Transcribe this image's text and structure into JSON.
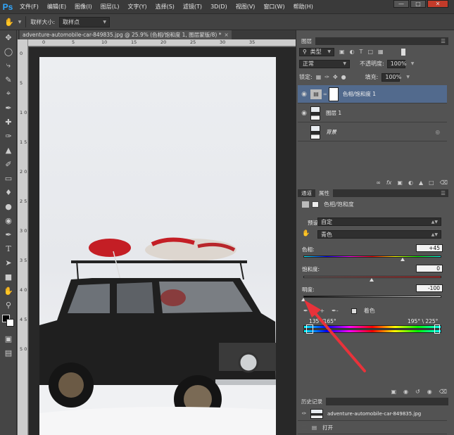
{
  "menu": {
    "logo": "Ps",
    "items": [
      "文件(F)",
      "编辑(E)",
      "图像(I)",
      "图层(L)",
      "文字(Y)",
      "选择(S)",
      "滤镜(T)",
      "3D(D)",
      "视图(V)",
      "窗口(W)",
      "帮助(H)"
    ],
    "win": {
      "min": "—",
      "max": "□",
      "close": "✕"
    }
  },
  "options": {
    "sample_size_label": "取样大小:",
    "sample_size_value": "取样点"
  },
  "document": {
    "tab_title": "adventure-automobile-car-849835.jpg @ 25.9% (色相/饱和度 1, 图层蒙版/8) *",
    "tab_close": "×",
    "ruler_top": [
      "0",
      "5",
      "10",
      "15",
      "20",
      "25",
      "30",
      "35"
    ],
    "ruler_left": [
      "0",
      "5",
      "1 0",
      "1 5",
      "2 0",
      "2 5",
      "3 0",
      "3 5",
      "4 0",
      "4 5",
      "5 0"
    ]
  },
  "layers": {
    "tab": "图层",
    "filter_label": "类型",
    "blend_mode": "正常",
    "opacity_label": "不透明度:",
    "opacity_value": "100%",
    "lock_label": "锁定:",
    "fill_label": "填充:",
    "fill_value": "100%",
    "rows": [
      {
        "name": "色相/饱和度 1"
      },
      {
        "name": "图层 1"
      },
      {
        "name": "背景"
      }
    ]
  },
  "properties": {
    "tab_inactive": "通道",
    "tab_active": "属性",
    "title": "色相/饱和度",
    "preset_label": "预设:",
    "preset_value": "自定",
    "channel_value": "青色",
    "hue_label": "色相:",
    "hue_value": "+45",
    "sat_label": "饱和度:",
    "sat_value": "0",
    "light_label": "明度:",
    "light_value": "-100",
    "colorize_label": "着色",
    "range_left": "135°/165°",
    "range_right": "195° \\ 225°"
  },
  "history": {
    "tab": "历史记录",
    "rows": [
      {
        "name": "adventure-automobile-car-849835.jpg"
      },
      {
        "name": "打开"
      }
    ]
  },
  "colors": {
    "accent": "#31a8ff",
    "selected_layer": "#526a8d",
    "arrow": "#e8323a"
  }
}
